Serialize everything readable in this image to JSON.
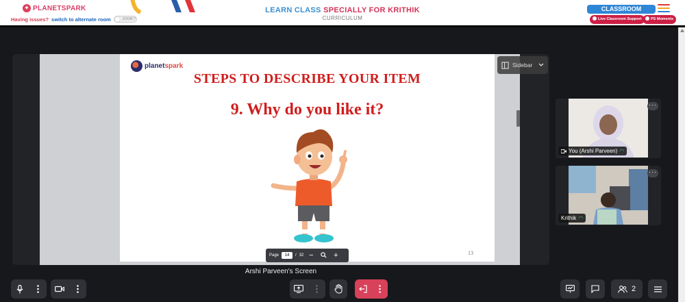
{
  "header": {
    "brand": "PLANETSPARK",
    "issues_text": "Having issues?",
    "switch_link": "switch to alternate room",
    "toggle_label": "ZOOM ?",
    "title_part1": "LEARN CLASS ",
    "title_part2": "SPECIALLY FOR KRITHIK",
    "subtitle": "CURRICULUM",
    "classroom_button": "CLASSROOM",
    "support_pill": "Live Classroom Support",
    "moments_pill": "PS Moments",
    "menu_colors": [
      "#e0352b",
      "#f1a31b",
      "#2a82d4"
    ]
  },
  "slide": {
    "logo_text_a": "planet",
    "logo_text_b": "spark",
    "title": "STEPS TO DESCRIBE YOUR ITEM",
    "question": "9. Why do you like it?",
    "slide_number": "13"
  },
  "pager": {
    "label": "Page",
    "current": "14",
    "separator": "/",
    "total": "32",
    "minus": "−",
    "plus": "+"
  },
  "sidebar_button": {
    "label": "Sidebar"
  },
  "share_caption": "Arshi Parveen's Screen",
  "participants": [
    {
      "name": "You (Arshi Parveen)",
      "more": "···"
    },
    {
      "name": "Krithik",
      "more": "···"
    }
  ],
  "controls": {
    "participant_count": "2"
  },
  "colors": {
    "accent_red": "#d11d1d",
    "leave_button": "#d8415a",
    "stage_bg": "#17181c"
  }
}
